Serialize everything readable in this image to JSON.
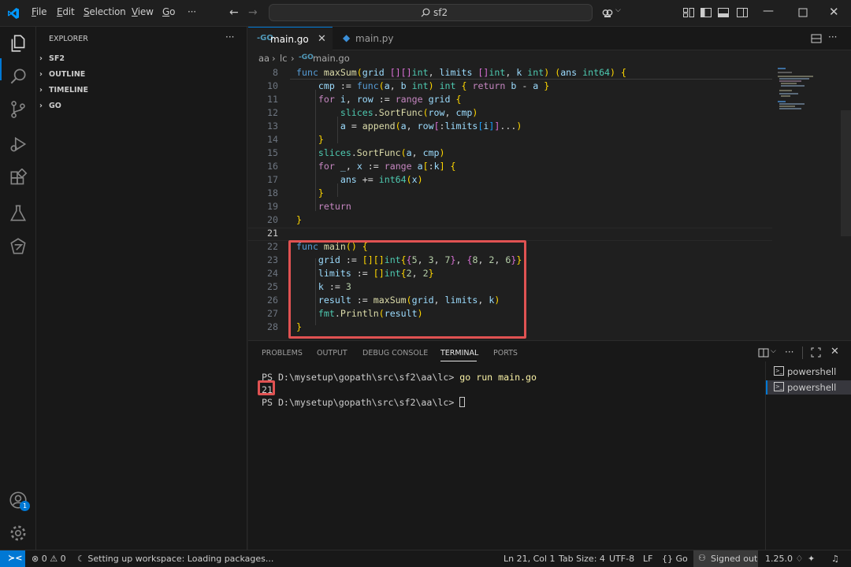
{
  "titlebar": {
    "menu": [
      {
        "label": "File",
        "ul": "F",
        "rest": "ile"
      },
      {
        "label": "Edit",
        "ul": "E",
        "rest": "dit"
      },
      {
        "label": "Selection",
        "ul": "S",
        "rest": "election"
      },
      {
        "label": "View",
        "ul": "V",
        "rest": "iew"
      },
      {
        "label": "Go",
        "ul": "G",
        "rest": "o"
      }
    ],
    "more": "···",
    "search_text": "sf2"
  },
  "sidebar": {
    "title": "EXPLORER",
    "more": "···",
    "sections": [
      "SF2",
      "OUTLINE",
      "TIMELINE",
      "GO"
    ]
  },
  "tabs": [
    {
      "label": "main.go",
      "active": true,
      "icon": "go-file-icon"
    },
    {
      "label": "main.py",
      "active": false,
      "icon": "python-file-icon"
    }
  ],
  "breadcrumb": [
    "aa",
    "lc",
    "main.go"
  ],
  "editor": {
    "lines": [
      {
        "n": "8",
        "text": "func maxSum(grid [][]int, limits []int, k int) (ans int64) {"
      },
      {
        "n": "10",
        "text": "    cmp := func(a, b int) int { return b - a }"
      },
      {
        "n": "11",
        "text": "    for i, row := range grid {"
      },
      {
        "n": "12",
        "text": "        slices.SortFunc(row, cmp)"
      },
      {
        "n": "13",
        "text": "        a = append(a, row[:limits[i]]...)"
      },
      {
        "n": "14",
        "text": "    }"
      },
      {
        "n": "15",
        "text": "    slices.SortFunc(a, cmp)"
      },
      {
        "n": "16",
        "text": "    for _, x := range a[:k] {"
      },
      {
        "n": "17",
        "text": "        ans += int64(x)"
      },
      {
        "n": "18",
        "text": "    }"
      },
      {
        "n": "19",
        "text": "    return"
      },
      {
        "n": "20",
        "text": "}"
      },
      {
        "n": "21",
        "text": ""
      },
      {
        "n": "22",
        "text": "func main() {"
      },
      {
        "n": "23",
        "text": "    grid := [][]int{{5, 3, 7}, {8, 2, 6}}"
      },
      {
        "n": "24",
        "text": "    limits := []int{2, 2}"
      },
      {
        "n": "25",
        "text": "    k := 3"
      },
      {
        "n": "26",
        "text": "    result := maxSum(grid, limits, k)"
      },
      {
        "n": "27",
        "text": "    fmt.Println(result)"
      },
      {
        "n": "28",
        "text": "}"
      }
    ]
  },
  "panel": {
    "tabs": [
      "PROBLEMS",
      "OUTPUT",
      "DEBUG CONSOLE",
      "TERMINAL",
      "PORTS"
    ],
    "active_tab": "TERMINAL",
    "terminal": {
      "prompt1": "PS D:\\mysetup\\gopath\\src\\sf2\\aa\\lc> ",
      "command": "go run main.go",
      "output": "21",
      "prompt2": "PS D:\\mysetup\\gopath\\src\\sf2\\aa\\lc> "
    },
    "terminals": [
      "powershell",
      "powershell"
    ],
    "toolbar_more": "···"
  },
  "status": {
    "errors": "0",
    "warnings": "0",
    "loading": "Setting up workspace: Loading packages...",
    "position": "Ln 21, Col 1",
    "tabsize": "Tab Size: 4",
    "encoding": "UTF-8",
    "eol": "LF",
    "language": "Go",
    "account": "Signed out",
    "version": "1.25.0"
  },
  "colors": {
    "accent": "#0078d4",
    "highlight_box": "#e05252",
    "badge": "#0078d4"
  }
}
